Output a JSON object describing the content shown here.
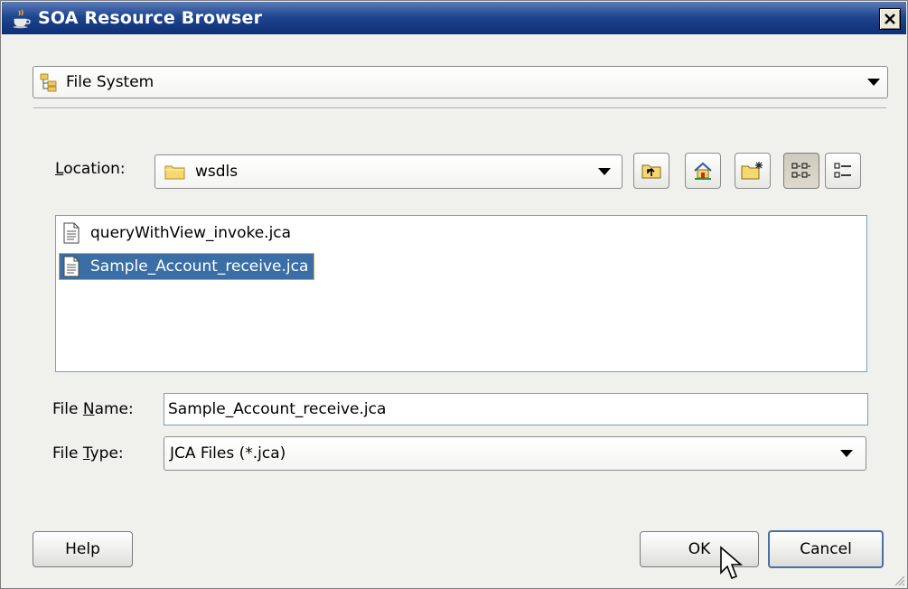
{
  "window": {
    "title": "SOA Resource Browser",
    "app_icon": "coffee-cup-icon",
    "close_icon": "close-icon"
  },
  "source_combo": {
    "selected": "File System",
    "icon": "file-system-tree-icon"
  },
  "location": {
    "label_prefix": "",
    "label_mnemonic": "L",
    "label_rest": "ocation:",
    "selected": "wsdls",
    "icon": "folder-icon"
  },
  "toolbar": {
    "up_icon": "folder-up-icon",
    "home_icon": "home-icon",
    "new_folder_icon": "new-folder-icon",
    "list_view_icon": "list-view-icon",
    "details_view_icon": "details-view-icon"
  },
  "files": [
    {
      "name": "queryWithView_invoke.jca",
      "icon": "document-icon",
      "selected": false
    },
    {
      "name": "Sample_Account_receive.jca",
      "icon": "document-icon",
      "selected": true
    }
  ],
  "file_name": {
    "label_prefix": "File ",
    "label_mnemonic": "N",
    "label_rest": "ame:",
    "value": "Sample_Account_receive.jca"
  },
  "file_type": {
    "label_prefix": "File ",
    "label_mnemonic": "T",
    "label_rest": "ype:",
    "selected": "JCA Files (*.jca)"
  },
  "buttons": {
    "help": "Help",
    "ok": "OK",
    "cancel": "Cancel"
  },
  "colors": {
    "title_bar": "#0e2f74",
    "selection": "#3a6ea5",
    "dialog_bg": "#f0f0ed"
  }
}
